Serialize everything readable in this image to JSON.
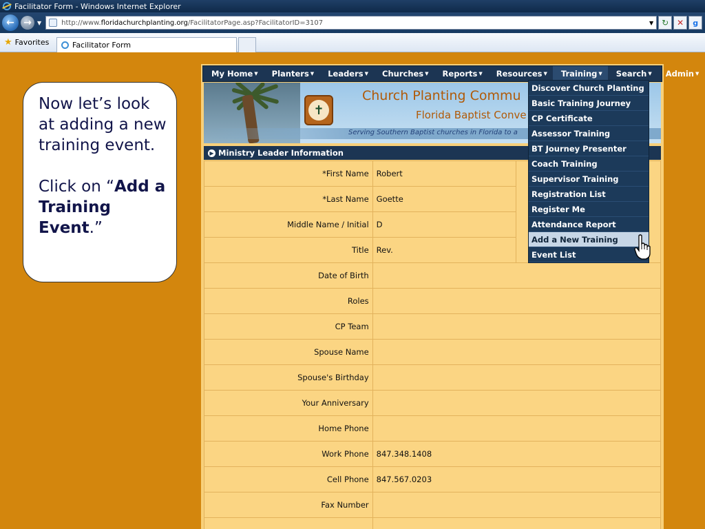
{
  "browser": {
    "window_title": "Facilitator Form - Windows Internet Explorer",
    "url_prefix": "http://www.",
    "url_domain": "floridachurchplanting.org",
    "url_path": "/FacilitatorPage.asp?FacilitatorID=3107",
    "favorites_label": "Favorites",
    "tab_title": "Facilitator Form"
  },
  "callout": {
    "line1": "Now let’s look at adding a new training event.",
    "line2_prefix": "Click on “",
    "line2_bold": "Add a Training Event",
    "line2_suffix": ".”"
  },
  "menu": {
    "items": [
      "My Home",
      "Planters",
      "Leaders",
      "Churches",
      "Reports",
      "Resources",
      "Training",
      "Search",
      "Admin"
    ]
  },
  "banner": {
    "title": "Church Planting Commu",
    "subtitle": "Florida Baptist Conve",
    "tagline": "Serving Southern Baptist churches in Florida to a"
  },
  "section_title": "Ministry Leader Information",
  "form": {
    "rows": [
      {
        "label": "*First Name",
        "value": "Robert"
      },
      {
        "label": "*Last Name",
        "value": "Goette"
      },
      {
        "label": "Middle Name / Initial",
        "value": "D"
      },
      {
        "label": "Title",
        "value": "Rev."
      },
      {
        "label": "Date of Birth",
        "value": ""
      },
      {
        "label": "Roles",
        "value": ""
      },
      {
        "label": "CP Team",
        "value": ""
      },
      {
        "label": "Spouse Name",
        "value": ""
      },
      {
        "label": "Spouse's Birthday",
        "value": ""
      },
      {
        "label": "Your Anniversary",
        "value": ""
      },
      {
        "label": "Home Phone",
        "value": ""
      },
      {
        "label": "Work Phone",
        "value": "847.348.1408"
      },
      {
        "label": "Cell Phone",
        "value": "847.567.0203"
      },
      {
        "label": "Fax Number",
        "value": ""
      },
      {
        "label": "",
        "value": ""
      }
    ]
  },
  "training_dropdown": {
    "items": [
      "Discover Church Planting",
      "Basic Training Journey",
      "CP Certificate",
      "Assessor Training",
      "BT Journey Presenter",
      "Coach Training",
      "Supervisor Training",
      "Registration List",
      "Register Me",
      "Attendance Report",
      "Add a New Training",
      "Event List"
    ],
    "hovered": "Add a New Training"
  },
  "colors": {
    "background": "#d3860d",
    "menu_bg": "#1c3553",
    "form_bg": "#fbd583",
    "banner_text": "#b05a08"
  }
}
